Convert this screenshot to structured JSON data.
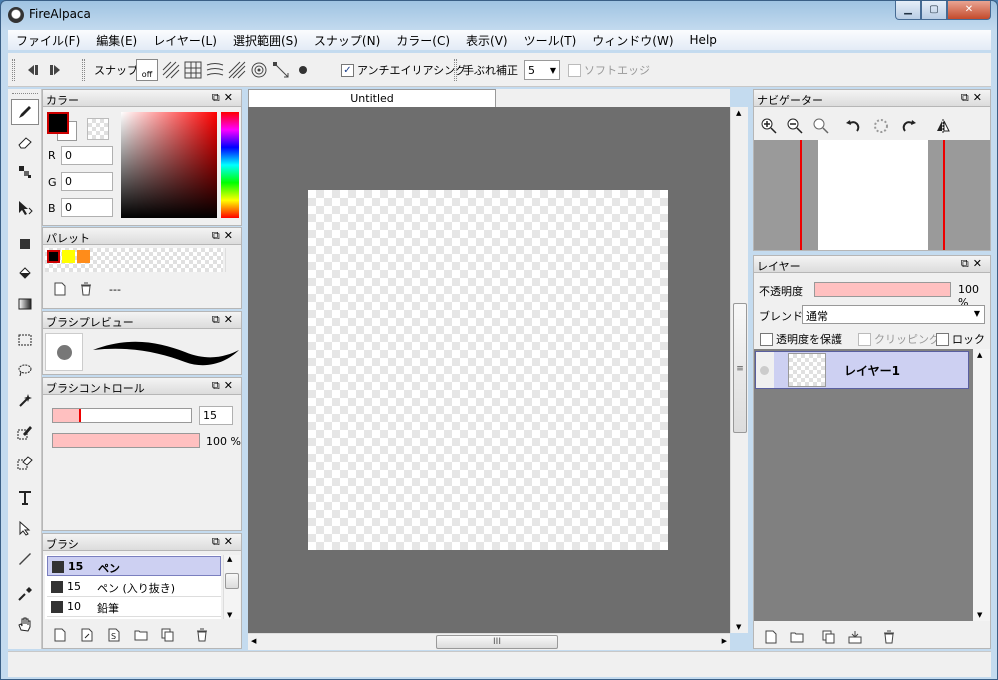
{
  "window": {
    "title": "FireAlpaca",
    "minimize": "▁",
    "maximize": "▢",
    "close": "✕"
  },
  "menu": [
    "ファイル(F)",
    "編集(E)",
    "レイヤー(L)",
    "選択範囲(S)",
    "スナップ(N)",
    "カラー(C)",
    "表示(V)",
    "ツール(T)",
    "ウィンドウ(W)",
    "Help"
  ],
  "toolbar": {
    "snap_label": "スナップ",
    "snap_off": "off",
    "antialias_label": "アンチエイリアシング",
    "antialias_checked": "✓",
    "stabilizer_label": "手ぶれ補正",
    "stabilizer_value": "5",
    "soft_edge_label": "ソフトエッジ"
  },
  "color_panel": {
    "title": "カラー",
    "r_label": "R",
    "r_value": "0",
    "g_label": "G",
    "g_value": "0",
    "b_label": "B",
    "b_value": "0",
    "primary_color": "#000000"
  },
  "palette_panel": {
    "title": "パレット",
    "swatches": [
      "#000000",
      "#ffff00",
      "#ff8c1a"
    ],
    "name": "---"
  },
  "brush_preview_panel": {
    "title": "ブラシプレビュー"
  },
  "brush_control_panel": {
    "title": "ブラシコントロール",
    "size_value": "15",
    "opacity_value": "100 %",
    "size_fraction": 0.19,
    "opacity_fraction": 1.0
  },
  "brush_panel": {
    "title": "ブラシ",
    "items": [
      {
        "size": "15",
        "name": "ペン"
      },
      {
        "size": "15",
        "name": "ペン (入り抜き)"
      },
      {
        "size": "10",
        "name": "鉛筆"
      }
    ]
  },
  "document": {
    "tab_title": "Untitled"
  },
  "navigator_panel": {
    "title": "ナビゲーター"
  },
  "layer_panel": {
    "title": "レイヤー",
    "opacity_label": "不透明度",
    "opacity_value": "100 %",
    "blend_label": "ブレンド",
    "blend_value": "通常",
    "protect_alpha_label": "透明度を保護",
    "clipping_label": "クリッピング",
    "lock_label": "ロック",
    "layers": [
      {
        "name": "レイヤー1"
      }
    ]
  },
  "colors": {
    "accent": "#cdd0f2",
    "slider_fill": "#ffc0c0",
    "canvas_bg": "#6e6e6e"
  },
  "scroll": {
    "grip": "III",
    "vgrip": "≡"
  }
}
